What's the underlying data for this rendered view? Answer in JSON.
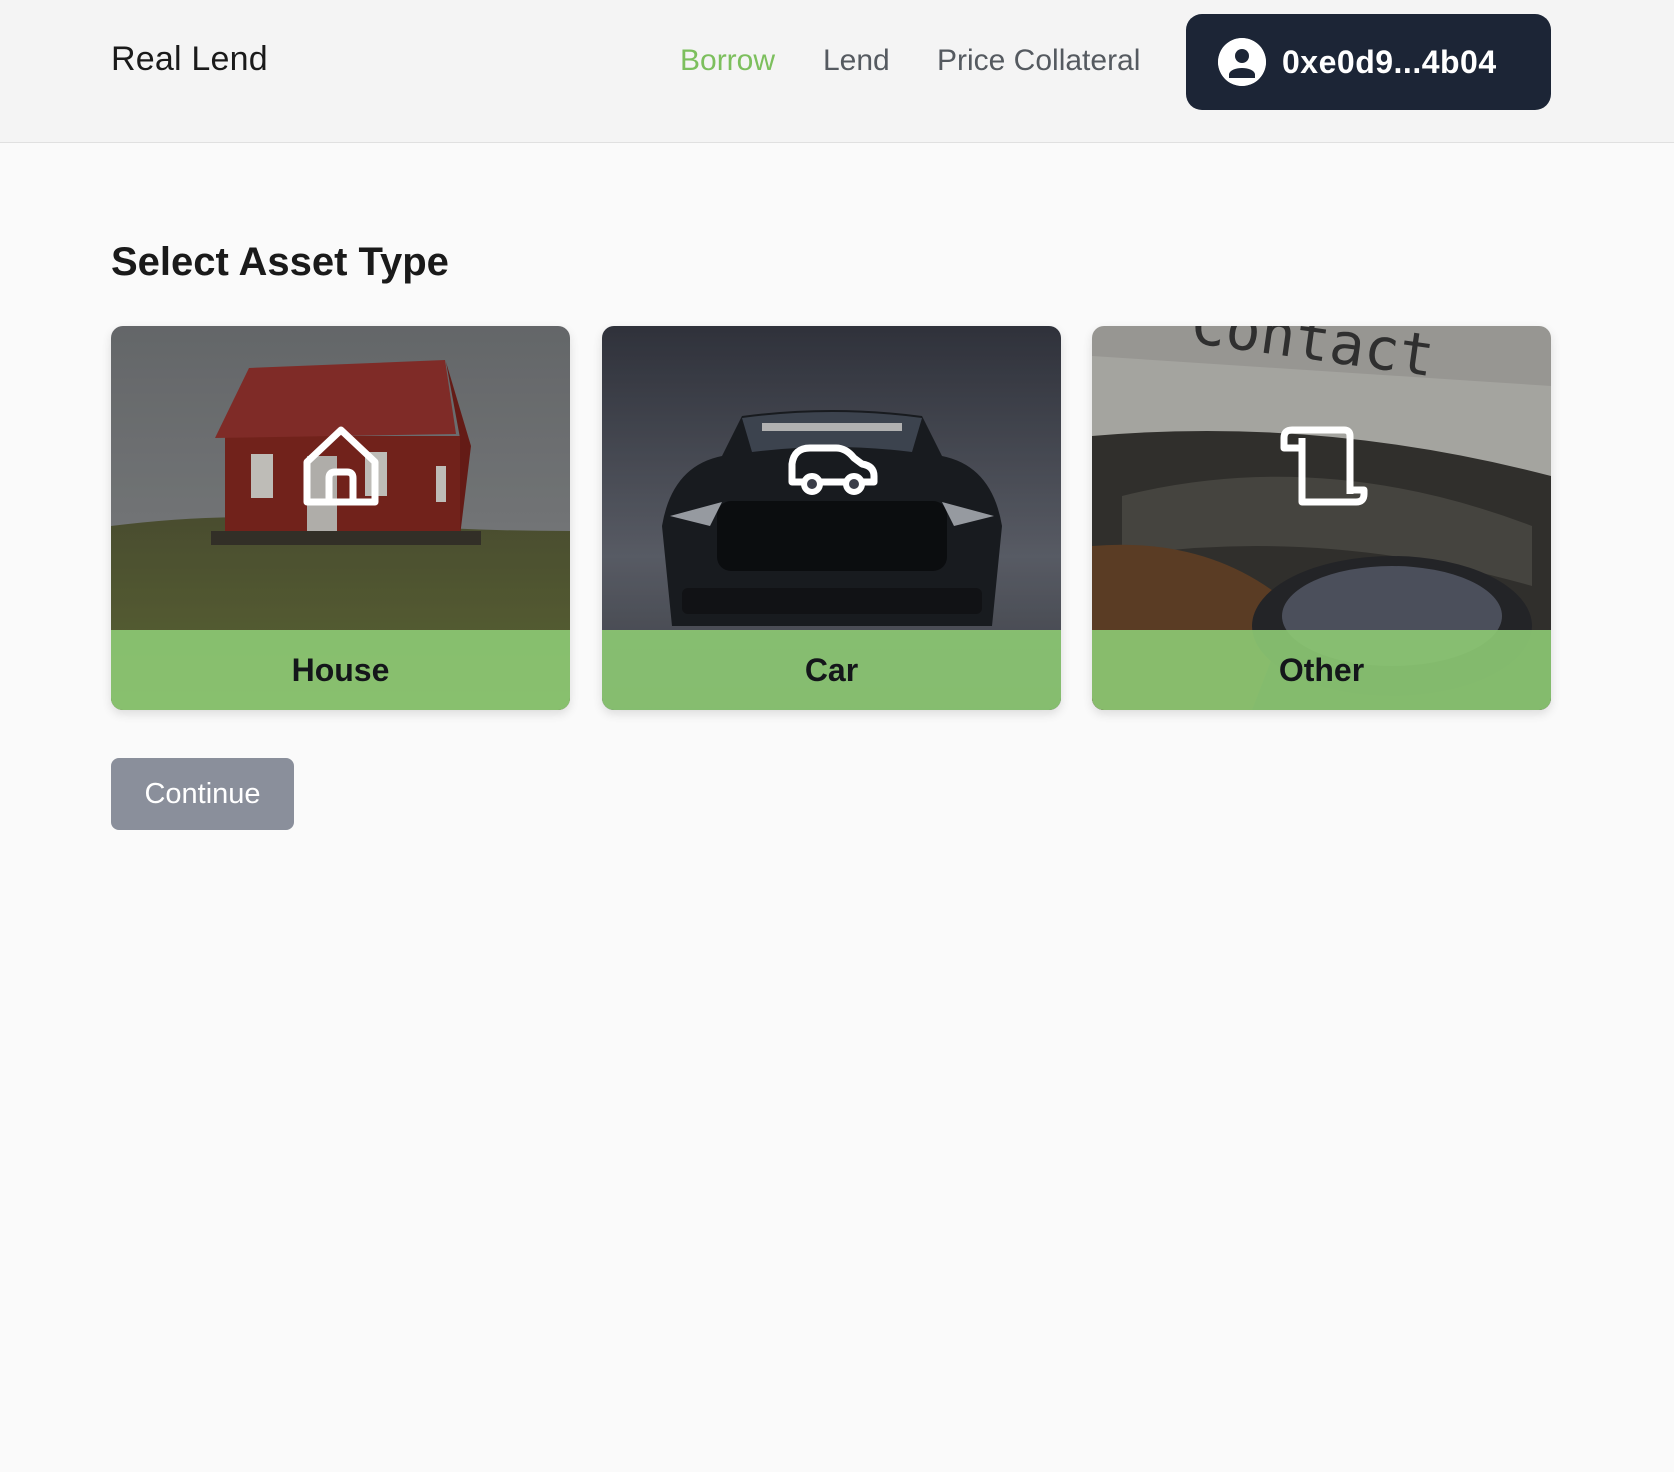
{
  "navbar": {
    "brand": "Real Lend",
    "links": [
      {
        "label": "Borrow",
        "active": true
      },
      {
        "label": "Lend",
        "active": false
      },
      {
        "label": "Price Collateral",
        "active": false
      }
    ],
    "wallet": {
      "address": "0xe0d9...4b04",
      "icon": "user-circle-icon"
    }
  },
  "main": {
    "title": "Select Asset Type",
    "asset_types": [
      {
        "label": "House",
        "icon": "house-icon",
        "image": "red house on grassy hill"
      },
      {
        "label": "Car",
        "icon": "car-icon",
        "image": "dark sports car front view"
      },
      {
        "label": "Other",
        "icon": "scroll-icon",
        "image": "typewriter with paper"
      }
    ],
    "continue_label": "Continue"
  },
  "colors": {
    "accent_green": "#7cbf5d",
    "card_label_bg": "#8cc873",
    "wallet_bg": "#1c2536",
    "continue_bg": "#8a8f9b"
  }
}
